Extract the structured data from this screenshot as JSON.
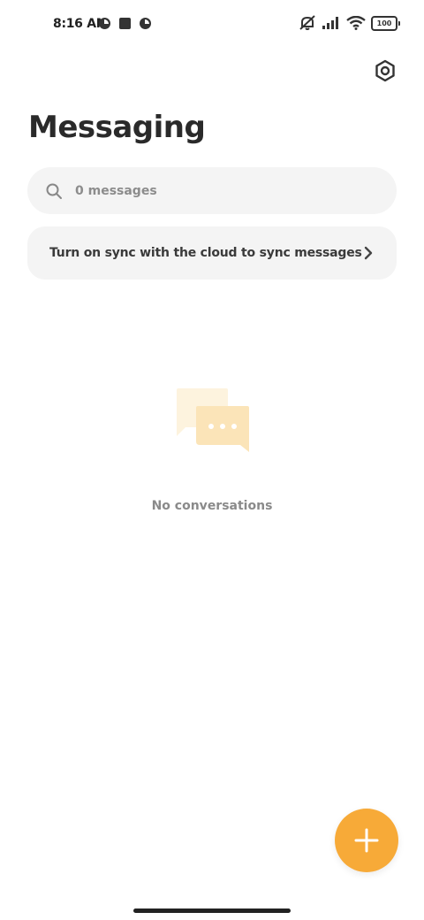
{
  "status_bar": {
    "time": "8:16 AM",
    "battery_level": "100",
    "icons": [
      "mute-icon",
      "signal-icon",
      "wifi-icon",
      "battery-icon"
    ]
  },
  "header": {
    "title": "Messaging",
    "settings_icon": "settings-hexagon-icon"
  },
  "search": {
    "placeholder": "0 messages",
    "value": ""
  },
  "sync_banner": {
    "text": "Turn on sync with the cloud to sync messages",
    "icon": "chevron-right-icon"
  },
  "empty_state": {
    "icon": "chat-bubbles-icon",
    "text": "No conversations"
  },
  "fab": {
    "icon": "plus-icon"
  },
  "colors": {
    "accent": "#f7aa38",
    "surface": "#f4f4f4",
    "illustration_light": "#fdf3de",
    "illustration_mid": "#fbe4b8"
  }
}
